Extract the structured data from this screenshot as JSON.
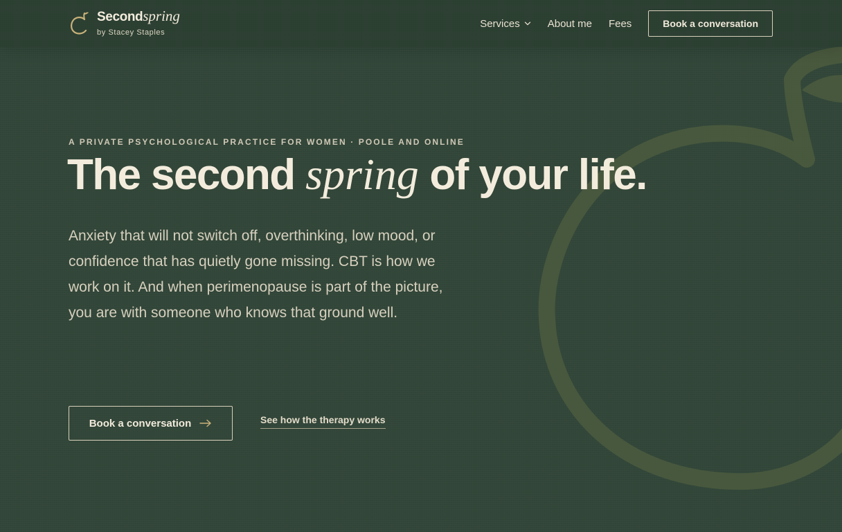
{
  "brand": {
    "name_bold": "Second",
    "name_script": "spring",
    "byline": "by Stacey Staples",
    "accent_color": "#c9b27a"
  },
  "nav": {
    "items": [
      {
        "label": "Services",
        "has_dropdown": true
      },
      {
        "label": "About me"
      },
      {
        "label": "Fees"
      }
    ],
    "cta_label": "Book a conversation"
  },
  "hero": {
    "eyebrow": "A PRIVATE PSYCHOLOGICAL PRACTICE FOR WOMEN · POOLE AND ONLINE",
    "headline_before": "The second",
    "headline_script": "spring",
    "headline_after": "of your life.",
    "lede": "Anxiety that will not switch off, overthinking, low mood, or confidence that has quietly gone missing. CBT is how we work on it. And when perimenopause is part of the picture, you are with someone who knows that ground well.",
    "primary_cta": "Book a conversation",
    "secondary_cta": "See how the therapy works"
  },
  "colors": {
    "background": "#34493b",
    "text": "#f3ecdc",
    "muted_text": "#d7d0be",
    "decor": "#4a5a3e"
  },
  "icons": {
    "logo": "fruit-icon",
    "dropdown": "chevron-down-icon",
    "cta_arrow": "arrow-right-icon"
  }
}
